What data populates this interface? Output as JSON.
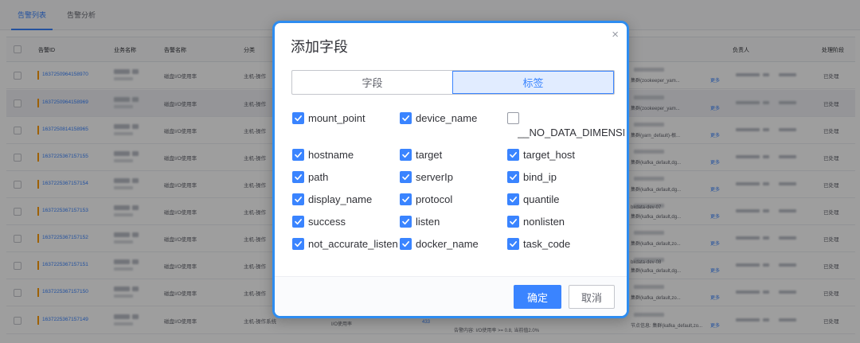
{
  "tabs": [
    {
      "label": "告警列表",
      "active": true
    },
    {
      "label": "告警分析",
      "active": false
    }
  ],
  "table": {
    "headers": [
      "告警ID",
      "业务名称",
      "告警名称",
      "分类",
      "负责人",
      "处理阶段"
    ],
    "rows": [
      {
        "id": "1637250964158970",
        "alarm": "磁盘I/O使用率",
        "category": "主机-操作",
        "node": "集群(zookeeper_yam...",
        "stage": "已处理"
      },
      {
        "id": "1637250964158969",
        "alarm": "磁盘I/O使用率",
        "category": "主机-操作",
        "node": "集群(zookeeper_yam...",
        "stage": "已处理"
      },
      {
        "id": "1637250814158965",
        "alarm": "磁盘I/O使用率",
        "category": "主机-操作",
        "node": "集群(yarn_default)-根...",
        "stage": "已处理"
      },
      {
        "id": "1637225367157155",
        "alarm": "磁盘I/O使用率",
        "category": "主机-操作",
        "node": "集群(kafka_default,dg...",
        "stage": "已处理"
      },
      {
        "id": "1637225367157154",
        "alarm": "磁盘I/O使用率",
        "category": "主机-操作",
        "node": "集群(kafka_default,dg...",
        "stage": "已处理"
      },
      {
        "id": "1637225367157153",
        "alarm": "磁盘I/O使用率",
        "category": "主机-操作",
        "node": "集群(kafka_default,dg...",
        "stage": "已处理"
      },
      {
        "id": "1637225367157152",
        "alarm": "磁盘I/O使用率",
        "category": "主机-操作",
        "node": "集群(kafka_default,zo...",
        "stage": "已处理"
      },
      {
        "id": "1637225367157151",
        "alarm": "磁盘I/O使用率",
        "category": "主机-操作",
        "node": "集群(kafka_default,dg...",
        "stage": "已处理"
      },
      {
        "id": "1637225367157150",
        "alarm": "磁盘I/O使用率",
        "category": "主机-操作",
        "node": "集群(kafka_default,zo...",
        "stage": "已处理"
      },
      {
        "id": "1637225367157149",
        "alarm": "磁盘I/O使用率",
        "category": "主机-操作系统",
        "node": "节点信息: 集群(kafka_default,zo...",
        "stage": "已处理"
      }
    ],
    "more_label": "更多",
    "extra_texts": [
      "bkdata-dev-07",
      "bkdata-dev-08",
      "I/O使用率",
      "433",
      "告警内容: I/O使用率 >= 0.8, 当前值2.0%"
    ]
  },
  "dialog": {
    "title": "添加字段",
    "close_icon": "×",
    "segments": [
      {
        "label": "字段",
        "active": false
      },
      {
        "label": "标签",
        "active": true
      }
    ],
    "fields": [
      {
        "label": "mount_point",
        "checked": true
      },
      {
        "label": "device_name",
        "checked": true
      },
      {
        "label": "__NO_DATA_DIMENSI",
        "checked": false
      },
      {
        "label": "hostname",
        "checked": true
      },
      {
        "label": "target",
        "checked": true
      },
      {
        "label": "target_host",
        "checked": true
      },
      {
        "label": "path",
        "checked": true
      },
      {
        "label": "serverIp",
        "checked": true
      },
      {
        "label": "bind_ip",
        "checked": true
      },
      {
        "label": "display_name",
        "checked": true
      },
      {
        "label": "protocol",
        "checked": true
      },
      {
        "label": "quantile",
        "checked": true
      },
      {
        "label": "success",
        "checked": true
      },
      {
        "label": "listen",
        "checked": true
      },
      {
        "label": "nonlisten",
        "checked": true
      },
      {
        "label": "not_accurate_listen",
        "checked": true
      },
      {
        "label": "docker_name",
        "checked": true
      },
      {
        "label": "task_code",
        "checked": true
      }
    ],
    "confirm_label": "确定",
    "cancel_label": "取消"
  },
  "colors": {
    "accent": "#3a84ff",
    "dialog_border": "#2d8cf0",
    "id_marker": "#ff9c01"
  }
}
